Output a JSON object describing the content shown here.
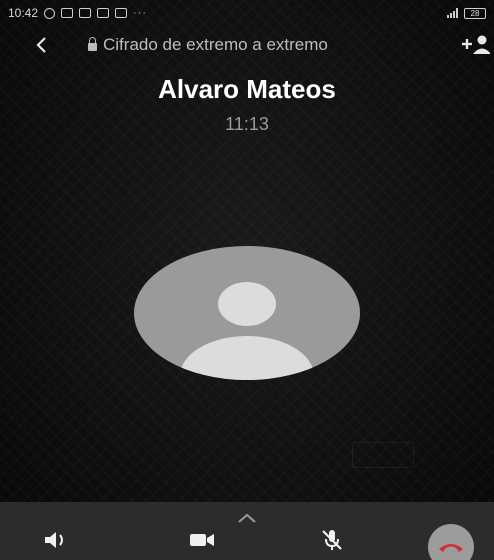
{
  "status_bar": {
    "time": "10:42",
    "battery_label": "28"
  },
  "top_bar": {
    "encryption_text": "Cifrado de extremo a extremo",
    "back_icon": "chevron-left-icon",
    "add_icon": "add-person-icon"
  },
  "call": {
    "caller_name": "Alvaro Mateos",
    "duration": "11:13"
  },
  "controls": {
    "expand_icon": "chevron-up-icon",
    "speaker_icon": "speaker-icon",
    "camera_icon": "video-camera-icon",
    "mute_icon": "microphone-off-icon",
    "end_call_icon": "end-call-icon"
  },
  "colors": {
    "background": "#101010",
    "control_bar": "#2c2c2c",
    "end_call_button": "#9c9c9c",
    "avatar_bg": "#9a9a9a",
    "avatar_fg": "#dcdcdc"
  }
}
